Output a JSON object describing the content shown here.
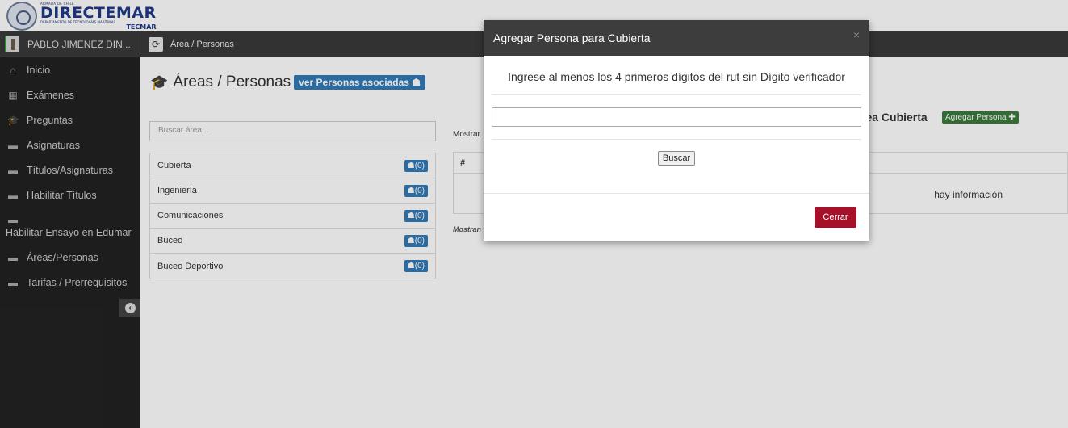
{
  "logo": {
    "small_text": "ARMADA DE CHILE",
    "name": "DIRECTEMAR",
    "subtitle": "DEPARTAMENTO DE TECNOLOGÍAS MARÍTIMAS",
    "tecmar": "TECMAR"
  },
  "navbar": {
    "user_name": "PABLO JIMENEZ DIN...",
    "refresh_icon": "refresh-icon",
    "breadcrumb": "Área / Personas"
  },
  "sidebar": {
    "items": [
      {
        "label": "Inicio",
        "icon": "home-icon",
        "glyph": "⌂"
      },
      {
        "label": "Exámenes",
        "icon": "calendar-icon",
        "glyph": "▦"
      },
      {
        "label": "Preguntas",
        "icon": "graduation-cap-icon",
        "glyph": "🎓"
      },
      {
        "label": "Asignaturas",
        "icon": "book-icon",
        "glyph": "▬"
      },
      {
        "label": "Títulos/Asignaturas",
        "icon": "book-icon",
        "glyph": "▬"
      },
      {
        "label": "Habilitar Títulos",
        "icon": "book-icon",
        "glyph": "▬"
      },
      {
        "label": "Habilitar Ensayo en Edumar",
        "icon": "book-icon",
        "glyph": "▬"
      },
      {
        "label": "Áreas/Personas",
        "icon": "book-icon",
        "glyph": "▬"
      },
      {
        "label": "Tarifas / Prerrequisitos",
        "icon": "book-icon",
        "glyph": "▬"
      }
    ],
    "collapse_icon": "arrow-circle-left-icon"
  },
  "main": {
    "title": "Áreas / Personas",
    "assoc_button": "ver Personas asociadas",
    "search_placeholder": "Buscar área...",
    "areas": [
      {
        "name": "Cubierta",
        "count": "(0)"
      },
      {
        "name": "Ingeniería",
        "count": "(0)"
      },
      {
        "name": "Comunicaciones",
        "count": "(0)"
      },
      {
        "name": "Buceo",
        "count": "(0)"
      },
      {
        "name": "Buceo Deportivo",
        "count": "(0)"
      }
    ],
    "right_title": "rea Cubierta",
    "agregar_button": "Agregar Persona",
    "mostrar_label": "Mostrar",
    "table_header": "#",
    "empty_text": "hay información",
    "mostrando_label": "Mostran"
  },
  "modal": {
    "title": "Agregar Persona para Cubierta",
    "close": "×",
    "message": "Ingrese al menos los 4 primeros dígitos del rut sin Dígito verificador",
    "input_value": "",
    "search_button": "Buscar",
    "close_button": "Cerrar"
  },
  "colors": {
    "primary_blue": "#337ab7",
    "success_green": "#3c7a3c",
    "danger_red": "#a51128",
    "sidebar_bg": "#222222",
    "navbar_bg": "#3a3a3a"
  }
}
